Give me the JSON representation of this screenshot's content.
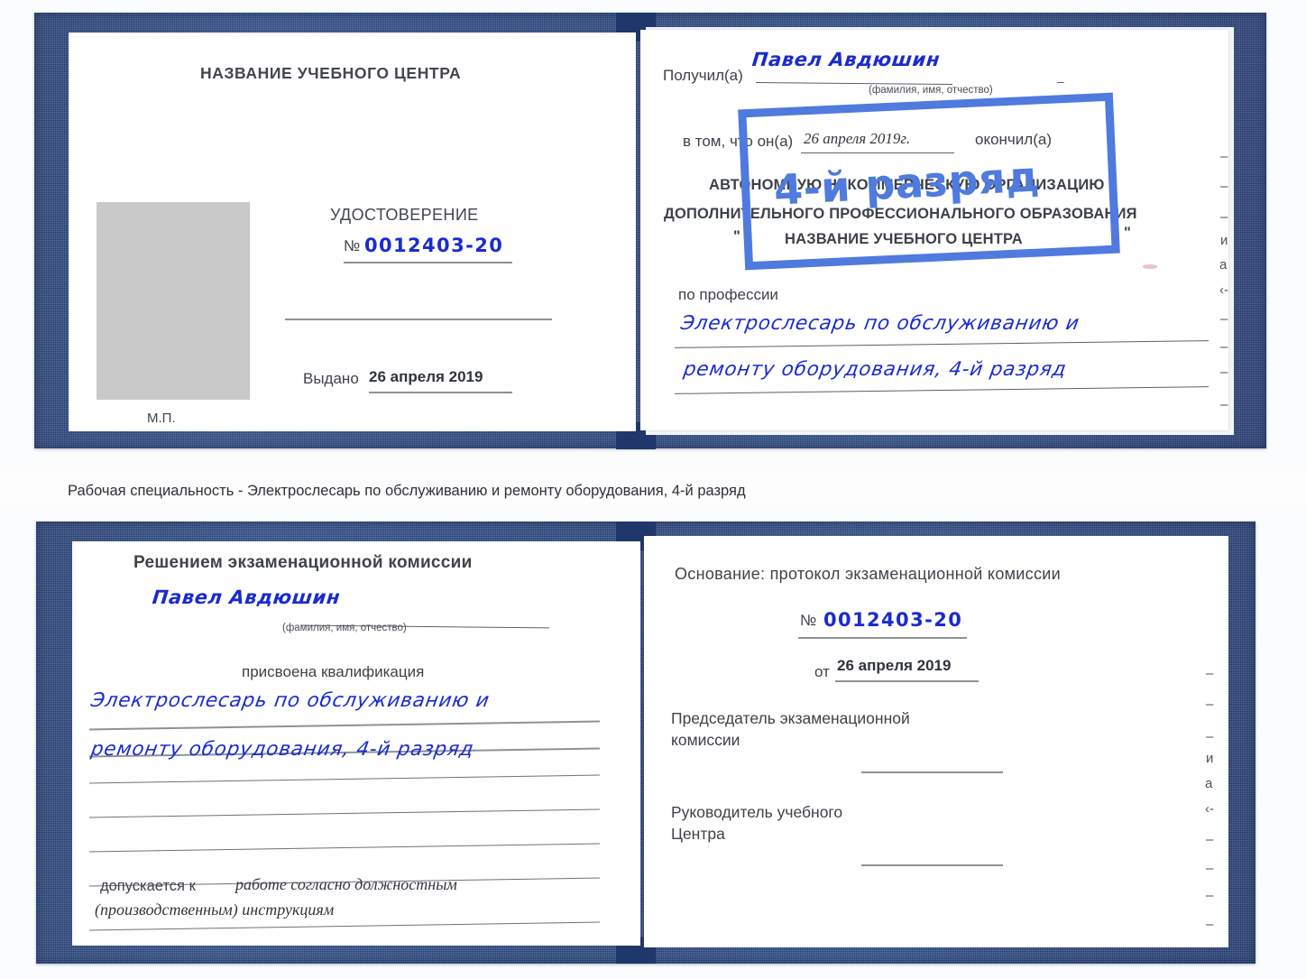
{
  "document": {
    "kind": "Удостоверение",
    "holder_name": "Павел Авдюшин",
    "certificate_number": "0012403-20",
    "issue_date": "26 апреля 2019",
    "issue_date_long": "26 апреля 2019г.",
    "profession": "Электрослесарь по обслуживанию и ремонту оборудования, 4-й разряд",
    "grade_stamp": "4-й разряд",
    "accent_blue": "#1a2bd0",
    "stamp_blue": "#4f7ade",
    "cover_blue": "#2c4a84"
  },
  "caption": {
    "text": "Рабочая специальность - Электрослесарь по обслуживанию и ремонту оборудования, 4-й разряд"
  },
  "cert_top": {
    "left_page": {
      "center_name": "НАЗВАНИЕ УЧЕБНОГО ЦЕНТРА",
      "title": "УДОСТОВЕРЕНИЕ",
      "number_symbol": "№",
      "number_value": "0012403-20",
      "issued_label": "Выдано",
      "issued_value": "26 апреля 2019",
      "seal_label": "М.П."
    },
    "right_page": {
      "received_label": "Получил(а)",
      "received_value": "Павел Авдюшин",
      "fio_hint": "(фамилия, имя, отчество)",
      "in_that_label": "в том, что он(а)",
      "in_that_date": "26 апреля 2019г.",
      "finished_label": "окончил(а)",
      "org_line1": "АВТОНОМНУЮ НЕКОММЕРЧЕСКУЮ ОРГАНИЗАЦИЮ",
      "org_line2": "ДОПОЛНИТЕЛЬНОГО ПРОФЕССИОНАЛЬНОГО ОБРАЗОВАНИЯ",
      "org_quote_open": "\"",
      "org_line3": "НАЗВАНИЕ УЧЕБНОГО ЦЕНТРА",
      "org_quote_close": "\"",
      "profession_label": "по профессии",
      "profession_line1": "Электрослесарь по обслуживанию и",
      "profession_line2": "ремонту оборудования, 4-й разряд",
      "stamp_text": "4-й разряд"
    },
    "edge_marks": [
      "–",
      "–",
      "–",
      "и",
      "а",
      "‹-",
      "–",
      "–",
      "–",
      "–"
    ]
  },
  "cert_bottom": {
    "left_page": {
      "heading": "Решением экзаменационной комиссии",
      "name_value": "Павел Авдюшин",
      "fio_hint": "(фамилия, имя, отчество)",
      "qualification_label": "присвоена квалификация",
      "qualification_line1": "Электрослесарь по обслуживанию и",
      "qualification_line2": "ремонту оборудования, 4-й разряд",
      "admitted_label": "допускается к",
      "admitted_value_line1": "работе согласно должностным",
      "admitted_value_line2": "(производственным) инструкциям"
    },
    "right_page": {
      "basis_label": "Основание: протокол экзаменационной комиссии",
      "number_symbol": "№",
      "number_value": "0012403-20",
      "from_label": "от",
      "from_value": "26 апреля 2019",
      "chairman_line1": "Председатель экзаменационной",
      "chairman_line2": "комиссии",
      "director_line1": "Руководитель учебного",
      "director_line2": "Центра"
    },
    "edge_marks": [
      "–",
      "–",
      "–",
      "и",
      "а",
      "‹-",
      "–",
      "–",
      "–",
      "–"
    ]
  }
}
